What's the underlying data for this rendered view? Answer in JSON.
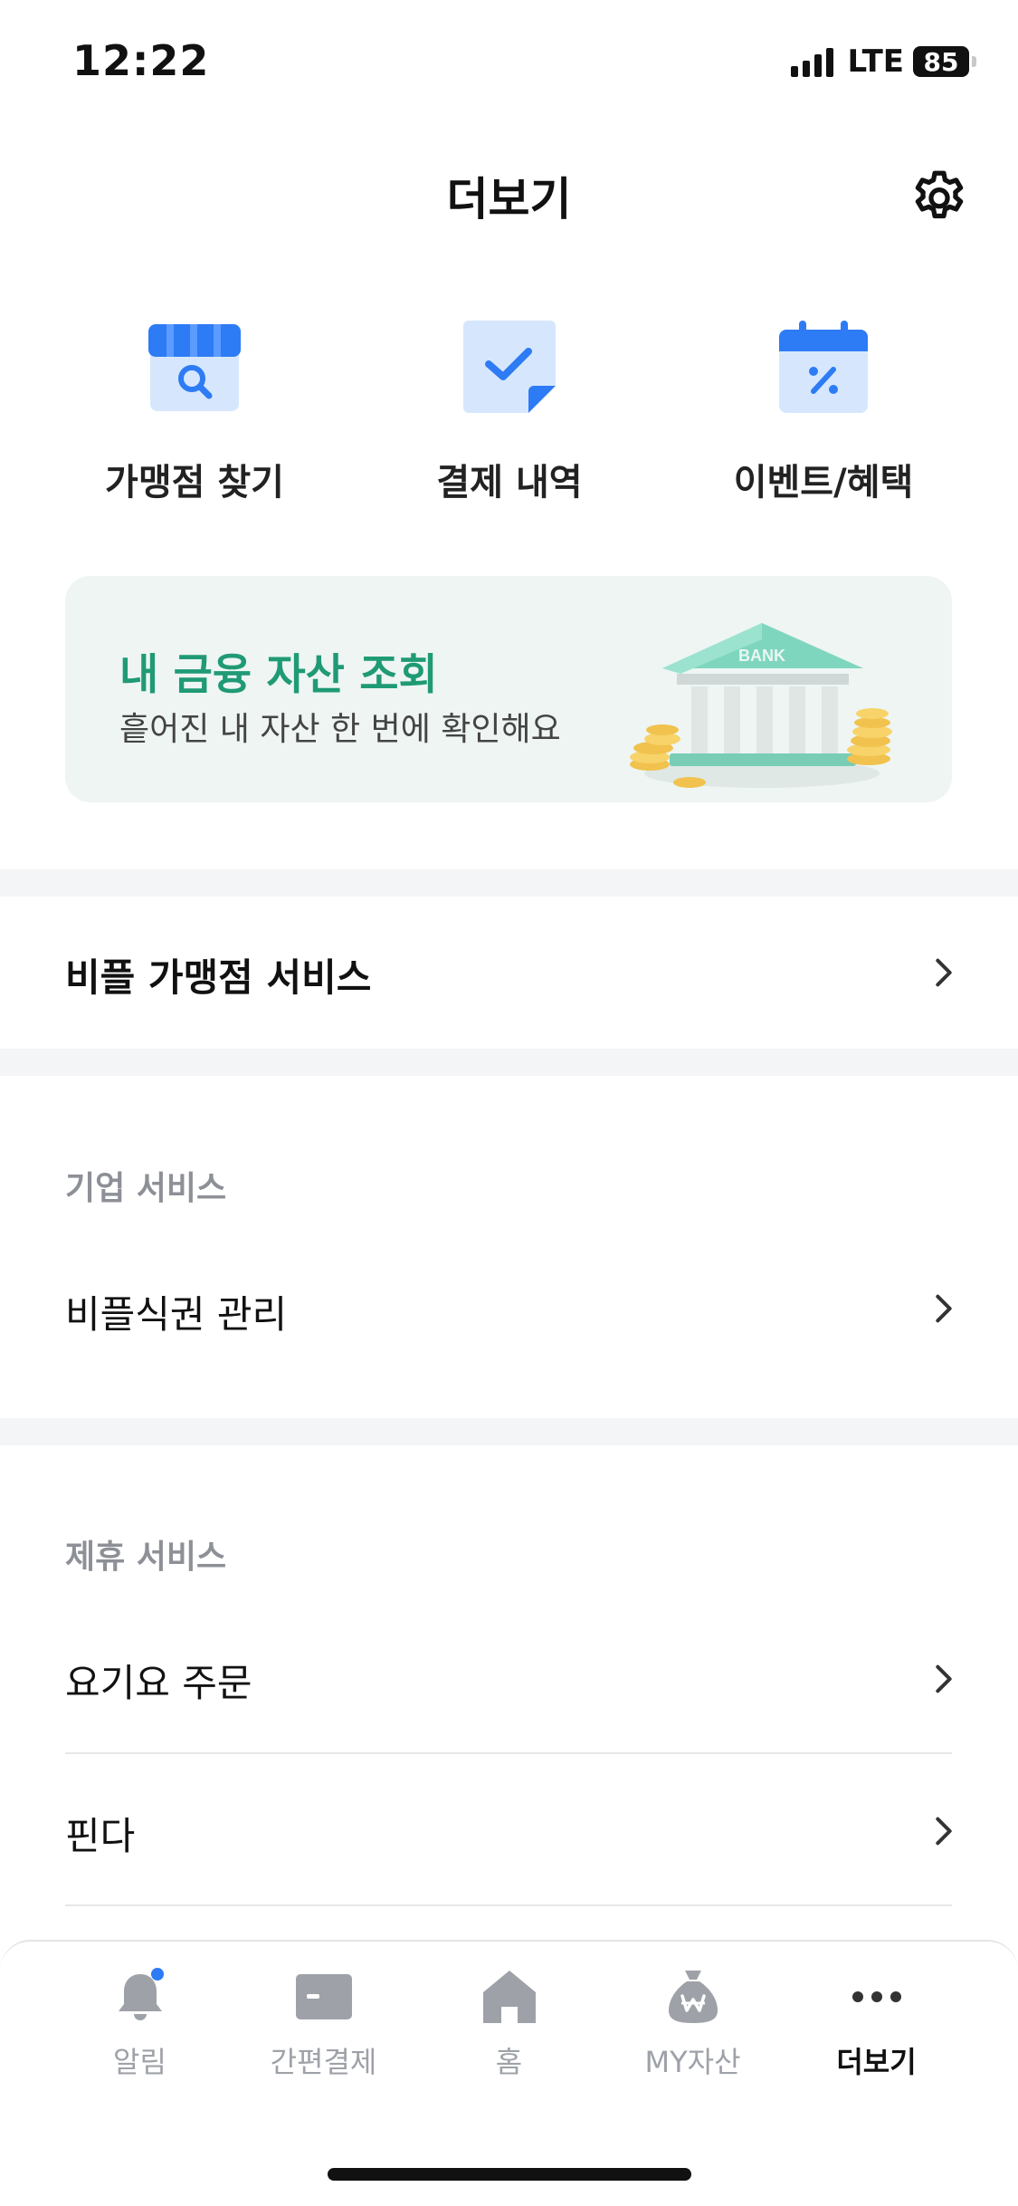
{
  "status_bar": {
    "time": "12:22",
    "network": "LTE",
    "battery": "85"
  },
  "header": {
    "title": "더보기"
  },
  "quick_actions": [
    {
      "label": "가맹점 찾기",
      "icon": "store-search-icon"
    },
    {
      "label": "결제 내역",
      "icon": "receipt-check-icon"
    },
    {
      "label": "이벤트/혜택",
      "icon": "calendar-percent-icon"
    }
  ],
  "banner": {
    "title": "내 금융 자산 조회",
    "subtitle": "흩어진 내 자산 한 번에 확인해요",
    "art_text": "BANK"
  },
  "merchant_service": {
    "label": "비플 가맹점 서비스"
  },
  "corporate": {
    "section_label": "기업 서비스",
    "items": [
      {
        "label": "비플식권 관리"
      }
    ]
  },
  "partner": {
    "section_label": "제휴 서비스",
    "items": [
      {
        "label": "요기요 주문"
      },
      {
        "label": "핀다"
      }
    ]
  },
  "bottom_nav": [
    {
      "label": "알림",
      "icon": "bell-icon",
      "badge": true
    },
    {
      "label": "간편결제",
      "icon": "card-icon"
    },
    {
      "label": "홈",
      "icon": "home-icon"
    },
    {
      "label": "MY자산",
      "icon": "money-bag-icon"
    },
    {
      "label": "더보기",
      "icon": "more-icon",
      "active": true
    }
  ],
  "colors": {
    "accent": "#1f9a75",
    "primary_blue": "#2d7bf5",
    "light_blue": "#d6e7fd",
    "inactive": "#9ea2a8"
  }
}
